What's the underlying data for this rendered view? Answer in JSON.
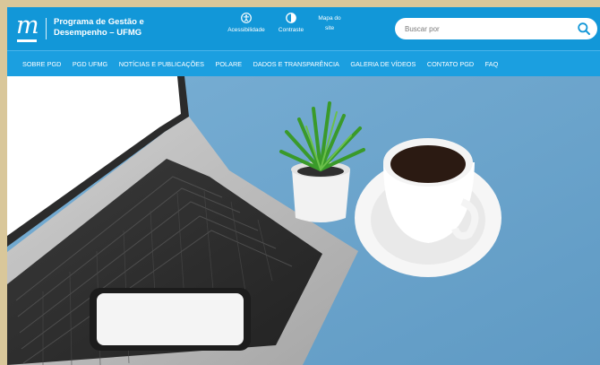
{
  "header": {
    "brand_line1": "Programa de Gestão e",
    "brand_line2": "Desempenho – UFMG",
    "logo_letter": "m",
    "tools": {
      "accessibility": "Acessibilidade",
      "contrast": "Contraste",
      "sitemap_line1": "Mapa do",
      "sitemap_line2": "site"
    },
    "search_placeholder": "Buscar por"
  },
  "nav": {
    "items": [
      "SOBRE PGD",
      "PGD UFMG",
      "NOTÍCIAS E PUBLICAÇÕES",
      "POLARE",
      "DADOS E TRANSPARÊNCIA",
      "GALERIA DE VÍDEOS",
      "CONTATO PGD",
      "FAQ"
    ]
  },
  "colors": {
    "header_bg": "#1297d8",
    "nav_bg": "#1b9fe0",
    "page_frame": "#d9c79a",
    "hero_desk": "#6fa7cf"
  },
  "icons": {
    "accessibility": "accessibility-icon",
    "contrast": "contrast-icon",
    "search": "search-icon"
  }
}
